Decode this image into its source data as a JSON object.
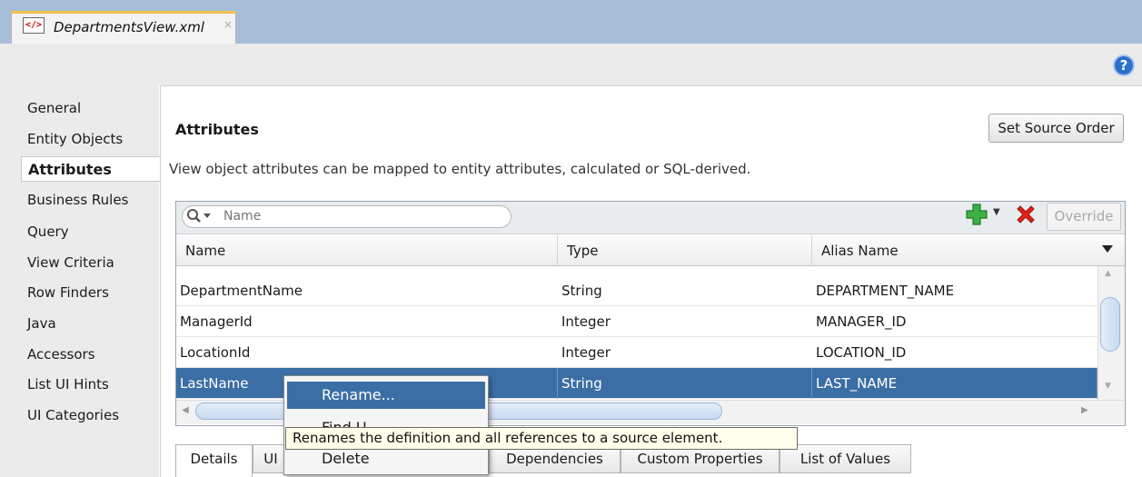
{
  "editor_tab": {
    "filename": "DepartmentsView.xml",
    "close_glyph": "×",
    "icon": "xml-file-icon"
  },
  "toolbar": {
    "help_glyph": "?",
    "help_icon": "help-icon"
  },
  "nav": {
    "items": [
      {
        "label": "General"
      },
      {
        "label": "Entity Objects"
      },
      {
        "label": "Attributes",
        "selected": true
      },
      {
        "label": "Business Rules"
      },
      {
        "label": "Query"
      },
      {
        "label": "View Criteria"
      },
      {
        "label": "Row Finders"
      },
      {
        "label": "Java"
      },
      {
        "label": "Accessors"
      },
      {
        "label": "List UI Hints"
      },
      {
        "label": "UI Categories"
      }
    ]
  },
  "main": {
    "heading": "Attributes",
    "set_source_order_label": "Set Source Order",
    "description": "View object attributes can be mapped to entity attributes, calculated or SQL-derived."
  },
  "search": {
    "placeholder": "Name",
    "value": ""
  },
  "panel_toolbar": {
    "add_icon": "plus-icon",
    "add_dropdown_glyph": "▼",
    "delete_icon": "red-x-icon",
    "override_label": "Override"
  },
  "table": {
    "columns": [
      "Name",
      "Type",
      "Alias Name"
    ],
    "rows": [
      {
        "name": "DepartmentName",
        "type": "String",
        "alias": "DEPARTMENT_NAME"
      },
      {
        "name": "ManagerId",
        "type": "Integer",
        "alias": "MANAGER_ID"
      },
      {
        "name": "LocationId",
        "type": "Integer",
        "alias": "LOCATION_ID"
      },
      {
        "name": "LastName",
        "type": "String",
        "alias": "LAST_NAME",
        "selected": true
      }
    ]
  },
  "bottom_tabs": [
    {
      "label": "Details",
      "selected": true
    },
    {
      "label": "UI"
    },
    {
      "label": "Dependencies"
    },
    {
      "label": "Custom Properties"
    },
    {
      "label": "List of Values"
    }
  ],
  "context_menu": {
    "items": [
      {
        "label": "Rename...",
        "highlighted": true
      },
      {
        "label": "Find U"
      },
      {
        "label": "Delete"
      }
    ]
  },
  "tooltip": {
    "text": "Renames the definition and all references to a source element."
  },
  "colors": {
    "tab_strip": "#a7bed8",
    "selection": "#3b6ea5",
    "tooltip_bg": "#fffeea",
    "help_blue": "#2d6fcc"
  }
}
